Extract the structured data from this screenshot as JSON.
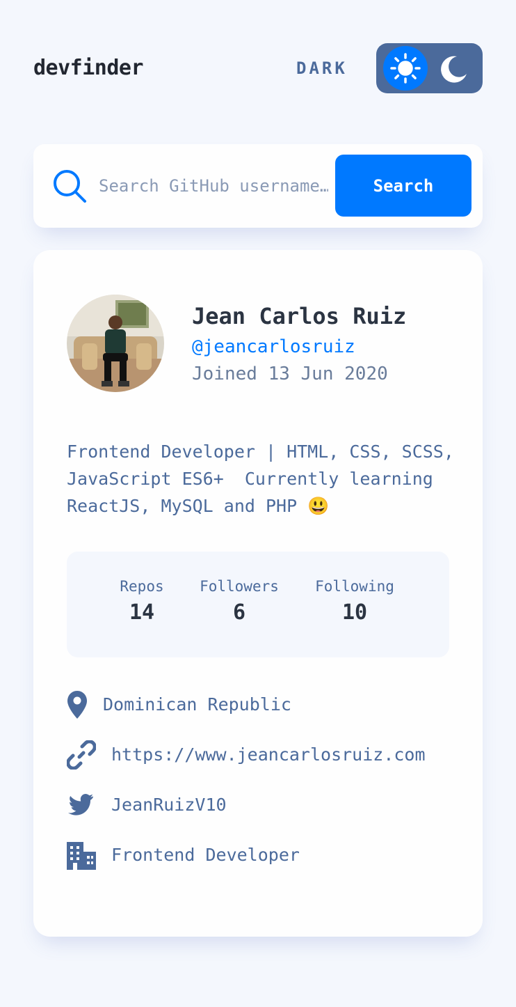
{
  "header": {
    "logo": "devfinder",
    "mode_label": "DARK",
    "theme_toggle": {
      "active": "light",
      "options": [
        "sun-icon",
        "moon-icon"
      ]
    }
  },
  "search": {
    "placeholder": "Search GitHub username…",
    "value": "",
    "button_label": "Search"
  },
  "profile": {
    "name": "Jean Carlos Ruiz",
    "login": "@jeancarlosruiz",
    "joined": "Joined 13 Jun 2020",
    "bio": "Frontend Developer | HTML, CSS, SCSS, JavaScript ES6+  Currently learning ReactJS, MySQL and PHP 😃",
    "stats": {
      "repos_label": "Repos",
      "repos": "14",
      "followers_label": "Followers",
      "followers": "6",
      "following_label": "Following",
      "following": "10"
    },
    "location": "Dominican Republic",
    "website": "https://www.jeancarlosruiz.com",
    "twitter": "JeanRuizV10",
    "company": "Frontend Developer"
  },
  "colors": {
    "background": "#f4f7fd",
    "card": "#fefefe",
    "accent": "#0079ff",
    "toggle": "#4b6a9b",
    "text": "#4b6a9b",
    "heading": "#2b3442"
  }
}
